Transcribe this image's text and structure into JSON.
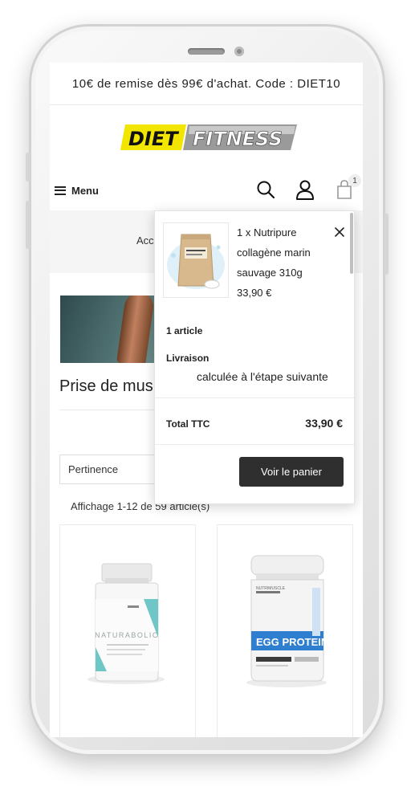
{
  "promo": {
    "text": "10€ de remise dès 99€ d'achat. Code : DIET10"
  },
  "header": {
    "logo": {
      "part1": "DIET",
      "part2": "FITNESS"
    },
    "menu_label": "Menu",
    "cart_count": "1"
  },
  "breadcrumb": {
    "text": "Acc"
  },
  "category": {
    "title": "Prise de mus",
    "sort_selected": "Pertinence",
    "count_text": "Affichage 1-12 de 59 article(s)"
  },
  "cart": {
    "item": {
      "line1": "1 x Nutripure",
      "line2": "collagène marin",
      "line3": "sauvage 310g",
      "price": "33,90 €"
    },
    "articles": "1 article",
    "shipping_label": "Livraison",
    "shipping_note": "calculée à l'étape suivante",
    "total_label": "Total TTC",
    "total_value": "33,90 €",
    "view_cart_label": "Voir le panier"
  },
  "products": [
    {
      "brand": "NATURABOLIC"
    },
    {
      "brand": "EGG PROTEIN",
      "maker": "NUTRIMUSCLE"
    }
  ],
  "colors": {
    "logo_yellow": "#f2e600",
    "button_dark": "#2f2f2f",
    "egg_blue": "#2f7fd0",
    "nat_teal": "#6ec6c6"
  },
  "icons": [
    "search-icon",
    "user-icon",
    "cart-icon",
    "close-icon",
    "menu-icon"
  ]
}
